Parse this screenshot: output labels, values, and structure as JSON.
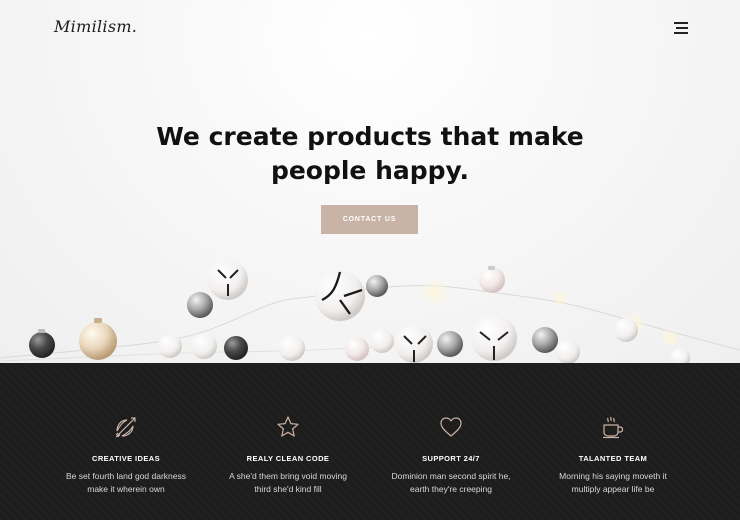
{
  "header": {
    "logo": "Mimilism.",
    "menu_icon": "hamburger-menu-icon"
  },
  "hero": {
    "title_line1": "We create products that make",
    "title_line2": "people happy.",
    "cta_label": "CONTACT US",
    "cta_color": "#c9b3a6"
  },
  "features": [
    {
      "icon": "bow-arrow-icon",
      "title": "CREATIVE IDEAS",
      "line1": "Be set fourth land god darkness",
      "line2": "make it wherein own"
    },
    {
      "icon": "star-icon",
      "title": "REALY CLEAN CODE",
      "line1": "A she'd them bring void moving",
      "line2": "third she'd kind fill"
    },
    {
      "icon": "heart-icon",
      "title": "SUPPORT 24/7",
      "line1": "Dominion man second spirit he,",
      "line2": "earth they're creeping"
    },
    {
      "icon": "coffee-cup-icon",
      "title": "TALANTED TEAM",
      "line1": "Morning his saying moveth it",
      "line2": "multiply appear life be"
    }
  ],
  "colors": {
    "accent": "#c9b3a6",
    "dark_section": "#1d1d1d",
    "icon_gold": "#c9b3a6"
  }
}
